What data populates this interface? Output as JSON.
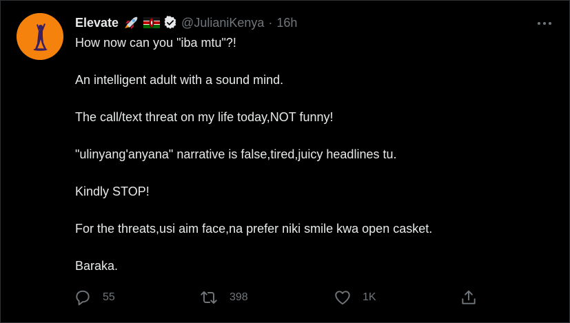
{
  "tweet": {
    "author": {
      "display_name": "Elevate",
      "handle": "@JulianiKenya",
      "verified": true,
      "name_emojis": [
        "rocket-emoji",
        "kenya-flag-emoji"
      ],
      "avatar_color": "#f5820d"
    },
    "separator": "·",
    "timestamp": "16h",
    "body": [
      "How now can you \"iba mtu\"?!",
      "An intelligent adult with a sound mind.",
      "The call/text threat on my life today,NOT funny!",
      "\"ulinyang'anyana\" narrative is false,tired,juicy headlines tu.",
      "Kindly STOP!",
      "For the threats,usi aim face,na prefer niki smile kwa open casket.",
      "Baraka."
    ],
    "actions": {
      "replies": "55",
      "retweets": "398",
      "likes": "1K"
    }
  },
  "colors": {
    "background": "#000000",
    "text_primary": "#e7e9ea",
    "text_secondary": "#71767b",
    "border": "#2f3336"
  },
  "icons": {
    "more": "more-horizontal-icon",
    "reply": "reply-icon",
    "retweet": "retweet-icon",
    "like": "heart-icon",
    "share": "share-icon",
    "verified": "verified-badge-icon"
  }
}
